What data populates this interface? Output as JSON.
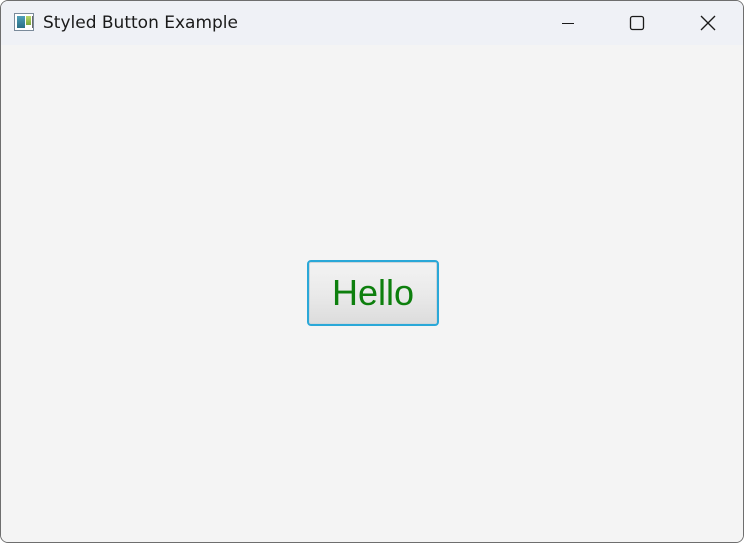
{
  "window": {
    "title": "Styled Button Example",
    "icon": "java-app-icon",
    "controls": {
      "minimize_icon": "minimize-icon",
      "maximize_icon": "maximize-icon",
      "close_icon": "close-icon"
    }
  },
  "content": {
    "button": {
      "label": "Hello",
      "text_color": "#0d7f0d",
      "border_color": "#2aa8d8",
      "focused": true
    },
    "background": "#f4f4f4"
  }
}
